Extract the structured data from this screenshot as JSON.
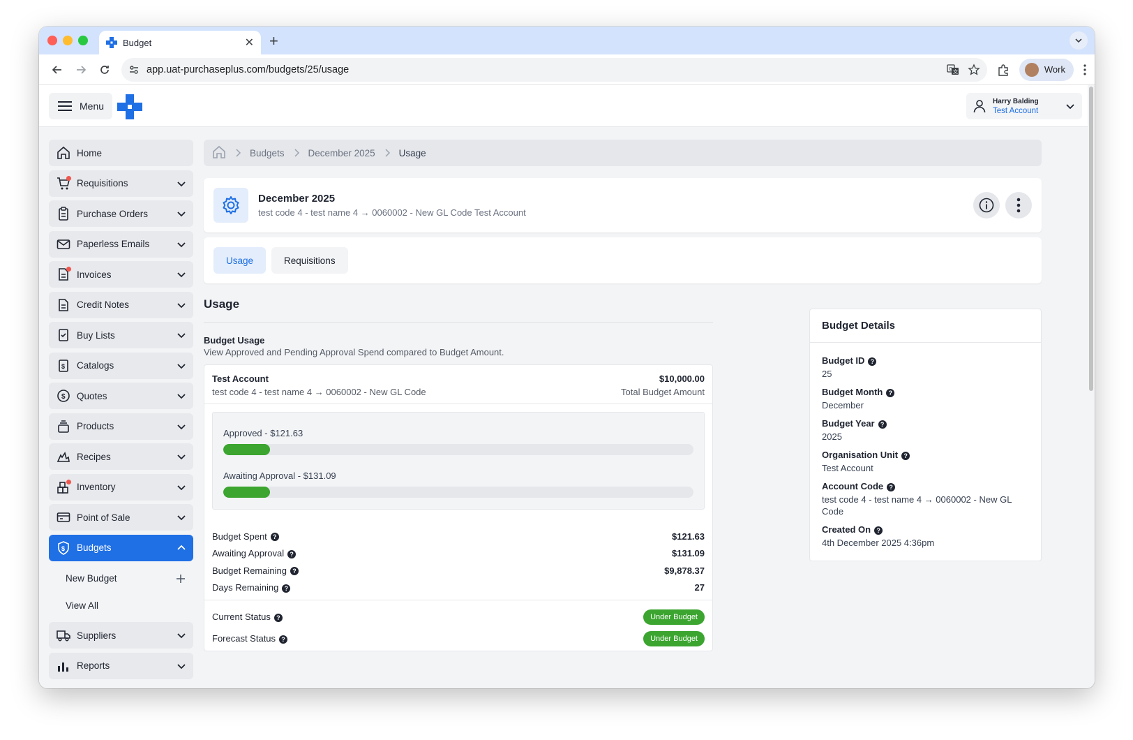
{
  "browser": {
    "tab_title": "Budget",
    "url": "app.uat-purchaseplus.com/budgets/25/usage",
    "profile_label": "Work"
  },
  "header": {
    "menu_label": "Menu",
    "user_name": "Harry Balding",
    "user_account": "Test Account"
  },
  "sidebar": {
    "items": [
      {
        "label": "Home",
        "icon": "home-icon",
        "chevron": false,
        "dot": false
      },
      {
        "label": "Requisitions",
        "icon": "cart-icon",
        "chevron": true,
        "dot": true
      },
      {
        "label": "Purchase Orders",
        "icon": "clipboard-icon",
        "chevron": true,
        "dot": false
      },
      {
        "label": "Paperless Emails",
        "icon": "envelope-icon",
        "chevron": true,
        "dot": false
      },
      {
        "label": "Invoices",
        "icon": "invoice-icon",
        "chevron": true,
        "dot": true
      },
      {
        "label": "Credit Notes",
        "icon": "document-icon",
        "chevron": true,
        "dot": false
      },
      {
        "label": "Buy Lists",
        "icon": "checklist-icon",
        "chevron": true,
        "dot": false
      },
      {
        "label": "Catalogs",
        "icon": "dollar-doc-icon",
        "chevron": true,
        "dot": false
      },
      {
        "label": "Quotes",
        "icon": "dollar-circle-icon",
        "chevron": true,
        "dot": false
      },
      {
        "label": "Products",
        "icon": "stack-icon",
        "chevron": true,
        "dot": false
      },
      {
        "label": "Recipes",
        "icon": "flame-icon",
        "chevron": true,
        "dot": false
      },
      {
        "label": "Inventory",
        "icon": "boxes-icon",
        "chevron": true,
        "dot": true
      },
      {
        "label": "Point of Sale",
        "icon": "card-icon",
        "chevron": true,
        "dot": false
      }
    ],
    "active": {
      "label": "Budgets",
      "icon": "shield-dollar-icon"
    },
    "sub_items": [
      {
        "label": "New Budget"
      },
      {
        "label": "View All"
      }
    ],
    "after": [
      {
        "label": "Suppliers",
        "icon": "truck-icon"
      },
      {
        "label": "Reports",
        "icon": "bar-chart-icon"
      }
    ]
  },
  "breadcrumb": {
    "items": [
      "Budgets",
      "December 2025"
    ],
    "current": "Usage"
  },
  "budget_header": {
    "title": "December 2025",
    "subtitle": "test code 4 - test name 4 → 0060002 - New GL Code Test Account"
  },
  "tabs": {
    "usage": "Usage",
    "requisitions": "Requisitions"
  },
  "usage": {
    "title": "Usage",
    "budget_usage_title": "Budget Usage",
    "budget_usage_desc": "View Approved and Pending Approval Spend compared to Budget Amount.",
    "account_name": "Test Account",
    "account_code": "test code 4 - test name 4 → 0060002 - New GL Code",
    "total_amount": "$10,000.00",
    "total_label": "Total Budget Amount",
    "approved_label": "Approved - $121.63",
    "approved_fraction": 0.1,
    "awaiting_label": "Awaiting Approval - $131.09",
    "awaiting_fraction": 0.1,
    "stats": {
      "spent_label": "Budget Spent",
      "spent_value": "$121.63",
      "awaiting_label": "Awaiting Approval",
      "awaiting_value": "$131.09",
      "remaining_label": "Budget Remaining",
      "remaining_value": "$9,878.37",
      "days_label": "Days Remaining",
      "days_value": "27"
    },
    "current_status_label": "Current Status",
    "current_status_value": "Under Budget",
    "forecast_status_label": "Forecast Status",
    "forecast_status_value": "Under Budget"
  },
  "details": {
    "title": "Budget Details",
    "budget_id_label": "Budget ID",
    "budget_id": "25",
    "month_label": "Budget Month",
    "month": "December",
    "year_label": "Budget Year",
    "year": "2025",
    "org_label": "Organisation Unit",
    "org": "Test Account",
    "account_code_label": "Account Code",
    "account_code": "test code 4 - test name 4 → 0060002 - New GL Code",
    "created_label": "Created On",
    "created": "4th December 2025 4:36pm"
  },
  "colors": {
    "primary": "#1f6fe5",
    "success": "#3ba52f",
    "notification": "#f0564d"
  }
}
